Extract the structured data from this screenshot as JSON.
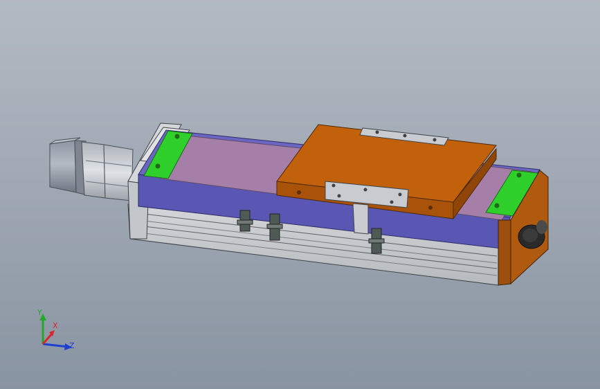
{
  "viewport": {
    "background_top": "#b3bac3",
    "background_bottom": "#8994a2"
  },
  "model": {
    "parts": [
      {
        "name": "servo-motor",
        "color": "#9aa2ad"
      },
      {
        "name": "motor-adapter-flange",
        "color": "#c9cdd1"
      },
      {
        "name": "rail-base-profile",
        "color": "#c5c8cc"
      },
      {
        "name": "linear-guide-cover",
        "color": "#5a57b4"
      },
      {
        "name": "dust-cover-strip",
        "color": "#a67fa8"
      },
      {
        "name": "carriage-plate",
        "color": "#c2610c"
      },
      {
        "name": "end-block-left-pad",
        "color": "#2fd02b"
      },
      {
        "name": "end-block-right-pad",
        "color": "#2fd02b"
      },
      {
        "name": "end-cap-right",
        "color": "#b05a10"
      },
      {
        "name": "cable-connector",
        "color": "#2a2a2a"
      },
      {
        "name": "limit-sensors",
        "color": "#4e5a56"
      }
    ]
  },
  "triad": {
    "x_label": "X",
    "y_label": "Y",
    "z_label": "Z",
    "x_color": "#d8262a",
    "y_color": "#22a82a",
    "z_color": "#1f3fd0"
  }
}
